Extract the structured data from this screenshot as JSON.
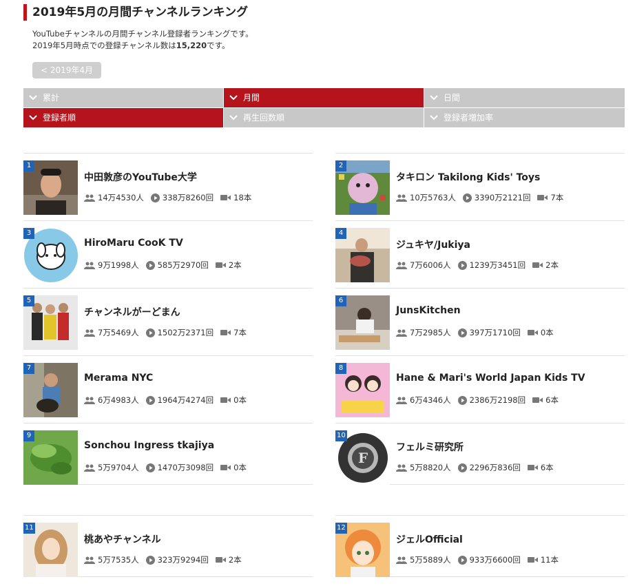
{
  "header": {
    "title": "2019年5月の月間チャンネルランキング",
    "desc_line1": "YouTubeチャンネルの月間チャンネル登録者ランキングです。",
    "desc_line2_prefix": "2019年5月時点での登録チャンネル数は",
    "desc_line2_count": "15,220",
    "desc_line2_suffix": "です。",
    "prev_button": "< 2019年4月"
  },
  "tabs": {
    "period": [
      {
        "label": "累計",
        "active": false
      },
      {
        "label": "月間",
        "active": true
      },
      {
        "label": "日間",
        "active": false
      }
    ],
    "sort": [
      {
        "label": "登録者順",
        "active": true
      },
      {
        "label": "再生回数順",
        "active": false
      },
      {
        "label": "登録者増加率",
        "active": false
      }
    ]
  },
  "icons": {
    "subscribers": "people-icon",
    "views": "play-circle-icon",
    "videos": "video-camera-icon",
    "tab": "chevron-down-icon"
  },
  "colors": {
    "accent_red": "#b5141c",
    "rank_blue": "#1f64b8",
    "tab_gray": "#c8c8c8"
  },
  "channels": [
    {
      "rank": "1",
      "name": "中田敦彦のYouTube大学",
      "subscribers": "14万4530人",
      "views": "338万8260回",
      "videos": "18本"
    },
    {
      "rank": "2",
      "name": "タキロン Takilong Kids' Toys",
      "subscribers": "10万5763人",
      "views": "3390万2121回",
      "videos": "7本"
    },
    {
      "rank": "3",
      "name": "HiroMaru CooK TV",
      "subscribers": "9万1998人",
      "views": "585万2970回",
      "videos": "2本"
    },
    {
      "rank": "4",
      "name": "ジュキヤ/Jukiya",
      "subscribers": "7万6006人",
      "views": "1239万3451回",
      "videos": "2本"
    },
    {
      "rank": "5",
      "name": "チャンネルがーどまん",
      "subscribers": "7万5469人",
      "views": "1502万2371回",
      "videos": "7本"
    },
    {
      "rank": "6",
      "name": "JunsKitchen",
      "subscribers": "7万2985人",
      "views": "397万1710回",
      "videos": "0本"
    },
    {
      "rank": "7",
      "name": "Merama NYC",
      "subscribers": "6万4983人",
      "views": "1964万4274回",
      "videos": "0本"
    },
    {
      "rank": "8",
      "name": "Hane & Mari's World Japan Kids TV",
      "subscribers": "6万4346人",
      "views": "2386万2198回",
      "videos": "6本"
    },
    {
      "rank": "9",
      "name": "Sonchou Ingress tkajiya",
      "subscribers": "5万9704人",
      "views": "1470万3098回",
      "videos": "0本"
    },
    {
      "rank": "10",
      "name": "フェルミ研究所",
      "subscribers": "5万8820人",
      "views": "2296万836回",
      "videos": "6本"
    },
    {
      "rank": "11",
      "name": "桃あやチャンネル",
      "subscribers": "5万7535人",
      "views": "323万9294回",
      "videos": "2本"
    },
    {
      "rank": "12",
      "name": "ジェルOfficial",
      "subscribers": "5万5889人",
      "views": "933万6600回",
      "videos": "11本"
    }
  ]
}
